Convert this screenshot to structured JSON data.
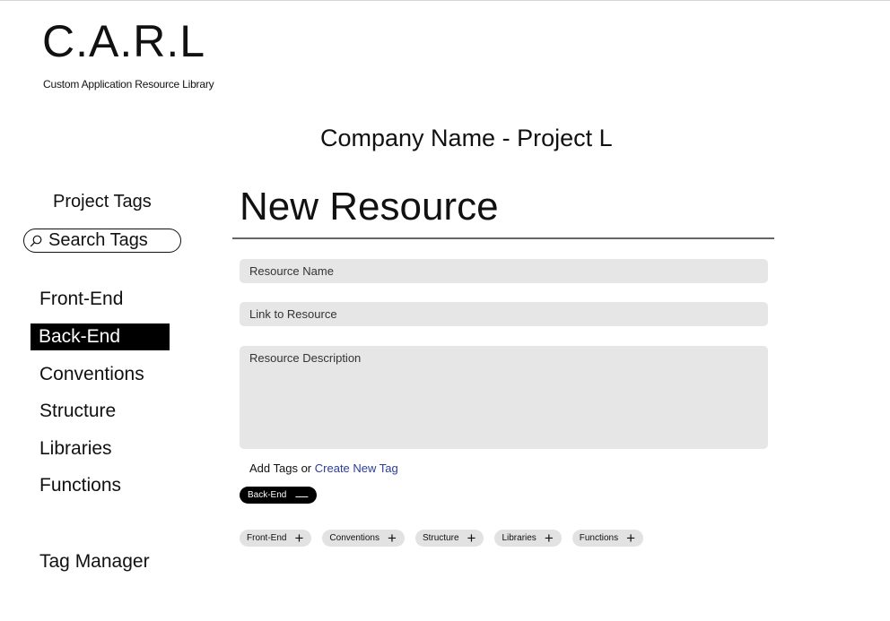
{
  "logo": {
    "title": "C.A.R.L",
    "subtitle": "Custom Application Resource Library"
  },
  "header": {
    "company": "Company Name - Project L"
  },
  "sidebar": {
    "heading": "Project Tags",
    "search_label": "Search Tags",
    "items": [
      {
        "label": "Front-End",
        "active": false
      },
      {
        "label": "Back-End",
        "active": true
      },
      {
        "label": "Conventions",
        "active": false
      },
      {
        "label": "Structure",
        "active": false
      },
      {
        "label": "Libraries",
        "active": false
      },
      {
        "label": "Functions",
        "active": false
      }
    ],
    "tag_manager": "Tag Manager"
  },
  "main": {
    "title": "New Resource",
    "fields": {
      "name_placeholder": "Resource Name",
      "link_placeholder": "Link to Resource",
      "description_placeholder": "Resource Description"
    },
    "add_tags_prefix": "Add Tags or ",
    "create_tag_link": "Create New Tag",
    "selected_tags": [
      {
        "label": "Back-End",
        "symbol": "—"
      }
    ],
    "available_tags": [
      {
        "label": "Front-End",
        "symbol": "+"
      },
      {
        "label": "Conventions",
        "symbol": "+"
      },
      {
        "label": "Structure",
        "symbol": "+"
      },
      {
        "label": "Libraries",
        "symbol": "+"
      },
      {
        "label": "Functions",
        "symbol": "+"
      }
    ]
  },
  "icons": {
    "search": "search-icon",
    "remove": "minus-icon",
    "add": "plus-icon"
  },
  "colors": {
    "active_bg": "#000000",
    "field_bg": "#e6e6e6",
    "chip_bg": "#e2e2e2",
    "link": "#2b3c9c"
  }
}
